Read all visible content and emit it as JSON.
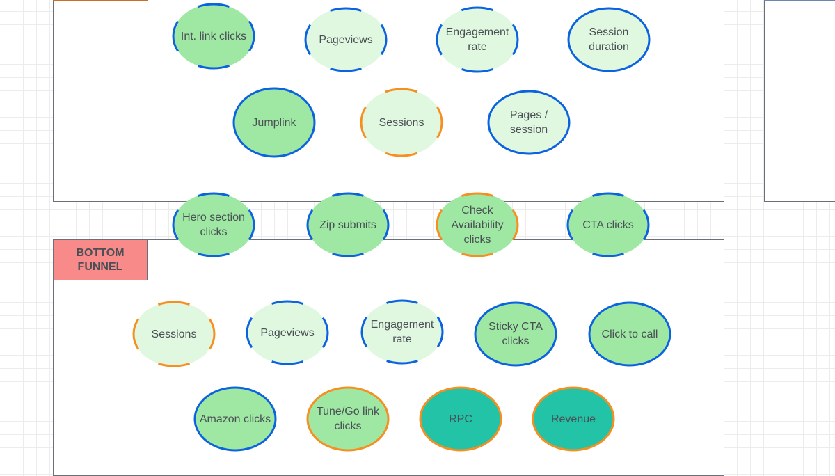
{
  "colors": {
    "fill_green": "#9ee8a3",
    "fill_light": "#e0f8e0",
    "fill_teal": "#22c3a6",
    "border_blue": "#0b63e0",
    "border_orange": "#f78f20",
    "bottom_funnel_label": "#f88a8a"
  },
  "sections": {
    "bottom_funnel": "BOTTOM\nFUNNEL"
  },
  "nodes": [
    {
      "label": "Int. link clicks",
      "fill": "green",
      "border": "blue",
      "style": "dashed"
    },
    {
      "label": "Pageviews",
      "fill": "light",
      "border": "blue",
      "style": "dashed"
    },
    {
      "label": "Engagement rate",
      "fill": "light",
      "border": "blue",
      "style": "dashed"
    },
    {
      "label": "Session duration",
      "fill": "light",
      "border": "blue",
      "style": "solid"
    },
    {
      "label": "Jumplink",
      "fill": "green",
      "border": "blue",
      "style": "solid"
    },
    {
      "label": "Sessions",
      "fill": "light",
      "border": "orange",
      "style": "dashed"
    },
    {
      "label": "Pages / session",
      "fill": "light",
      "border": "blue",
      "style": "solid"
    },
    {
      "label": "Hero section clicks",
      "fill": "green",
      "border": "blue",
      "style": "dashed"
    },
    {
      "label": "Zip submits",
      "fill": "green",
      "border": "blue",
      "style": "dashed"
    },
    {
      "label": "Check Availability clicks",
      "fill": "green",
      "border": "orange",
      "style": "dashed"
    },
    {
      "label": "CTA clicks",
      "fill": "green",
      "border": "blue",
      "style": "dashed"
    },
    {
      "label": "Sessions",
      "fill": "light",
      "border": "orange",
      "style": "dashed"
    },
    {
      "label": "Pageviews",
      "fill": "light",
      "border": "blue",
      "style": "dashed"
    },
    {
      "label": "Engagement rate",
      "fill": "light",
      "border": "blue",
      "style": "dashed"
    },
    {
      "label": "Sticky CTA clicks",
      "fill": "green",
      "border": "blue",
      "style": "solid"
    },
    {
      "label": "Click to call",
      "fill": "green",
      "border": "blue",
      "style": "solid"
    },
    {
      "label": "Amazon clicks",
      "fill": "green",
      "border": "blue",
      "style": "solid"
    },
    {
      "label": "Tune/Go link clicks",
      "fill": "green",
      "border": "orange",
      "style": "solid"
    },
    {
      "label": "RPC",
      "fill": "teal",
      "border": "orange",
      "style": "solid"
    },
    {
      "label": "Revenue",
      "fill": "teal",
      "border": "orange",
      "style": "solid"
    }
  ]
}
